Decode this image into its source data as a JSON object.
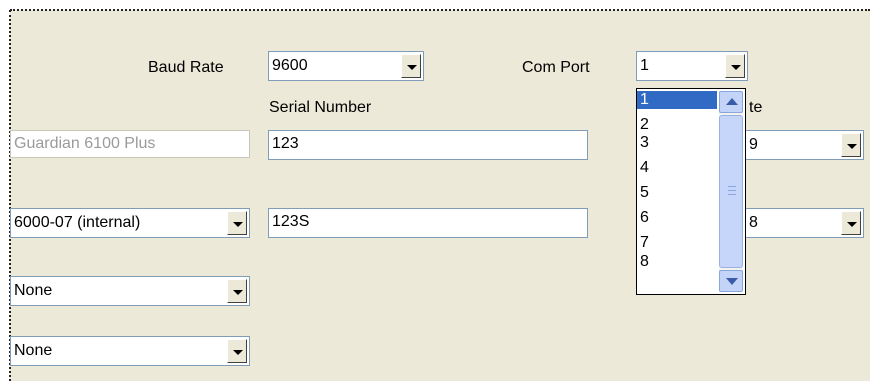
{
  "baud_rate": {
    "label": "Baud Rate",
    "value": "9600"
  },
  "com_port": {
    "label": "Com Port",
    "value": "1"
  },
  "serial_number": {
    "header": "Serial Number"
  },
  "rows": [
    {
      "left": "Guardian 6100 Plus",
      "serial": "123",
      "right_value": "9",
      "right_header_fragment": "te"
    },
    {
      "left": "6000-07 (internal)",
      "serial": "123S",
      "right_value": "8"
    },
    {
      "left": "None"
    },
    {
      "left": "None"
    }
  ],
  "com_port_options": [
    "1",
    "2",
    "3",
    "4",
    "5",
    "6",
    "7",
    "8"
  ],
  "selected_option": "1",
  "colors": {
    "selection": "#316ac5",
    "panel": "#ece9d8",
    "field_border": "#7f9db9"
  },
  "icons": {
    "dropdown": "chevron-down-icon",
    "scroll_up": "scroll-up-icon",
    "scroll_down": "scroll-down-icon"
  }
}
